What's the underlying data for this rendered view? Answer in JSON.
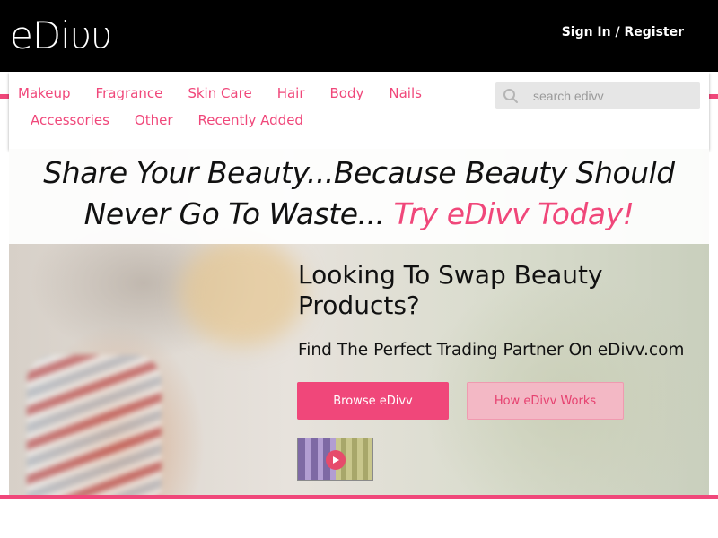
{
  "header": {
    "logo": "eDiυυ",
    "signin": "Sign In / Register"
  },
  "nav": {
    "row1": [
      "Makeup",
      "Fragrance",
      "Skin Care",
      "Hair",
      "Body",
      "Nails"
    ],
    "row2": [
      "Accessories",
      "Other",
      "Recently Added"
    ]
  },
  "search": {
    "placeholder": "search edivv",
    "value": ""
  },
  "tagline": {
    "line1": "Share Your Beauty...Because Beauty Should",
    "line2_plain": "Never Go To Waste... ",
    "line2_accent": "Try eDivv Today!"
  },
  "hero": {
    "heading": "Looking To Swap Beauty Products?",
    "subheading": "Find The Perfect Trading Partner On eDivv.com",
    "browse_button": "Browse eDivv",
    "how_button": "How eDivv Works"
  },
  "icons": {
    "search": "search-icon",
    "play": "play-icon"
  },
  "colors": {
    "accent": "#f0477a",
    "header_bg": "#000000"
  }
}
